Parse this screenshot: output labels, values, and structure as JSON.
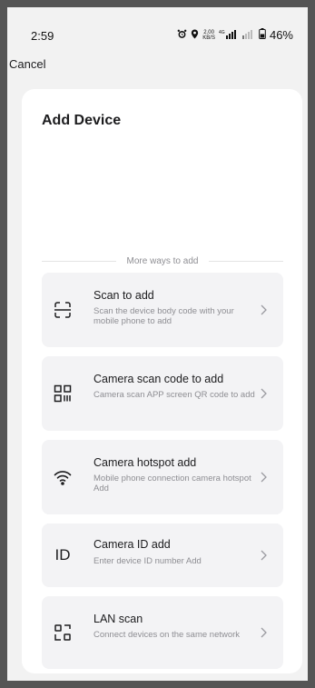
{
  "status_bar": {
    "time": "2:59",
    "speed_top": "2.00",
    "speed_bottom": "KB/S",
    "net": "4G",
    "battery": "46%"
  },
  "nav": {
    "cancel_label": "Cancel"
  },
  "page": {
    "title": "Add Device"
  },
  "divider": {
    "label": "More ways to add"
  },
  "options": [
    {
      "title": "Scan to add",
      "desc": "Scan the device body code with your mobile phone to add",
      "icon": "scan-frame-icon"
    },
    {
      "title": "Camera scan code to add",
      "desc": "Camera scan APP screen QR code to add",
      "icon": "qr-code-icon"
    },
    {
      "title": "Camera hotspot add",
      "desc": "Mobile phone connection camera hotspot Add",
      "icon": "wifi-icon"
    },
    {
      "title": "Camera ID add",
      "desc": "Enter device ID number Add",
      "icon": "id-icon",
      "icon_text": "ID"
    },
    {
      "title": "LAN scan",
      "desc": "Connect devices on the same network",
      "icon": "lan-scan-icon"
    }
  ]
}
